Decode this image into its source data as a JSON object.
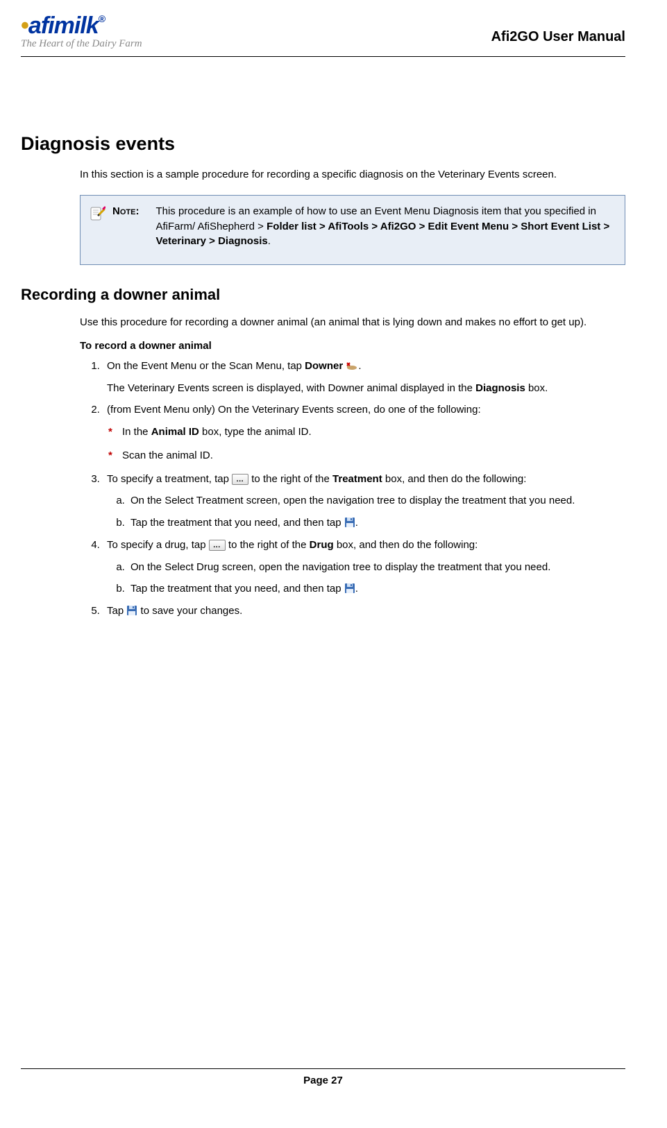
{
  "header": {
    "brand": "afimilk",
    "tagline": "The Heart of the Dairy Farm",
    "doc_title": "Afi2GO User Manual"
  },
  "h1": "Diagnosis events",
  "intro": "In this section is a sample procedure for recording a specific diagnosis on the Veterinary Events screen.",
  "note": {
    "label": "Note:",
    "text_a": "This procedure is an example of how to use an Event Menu Diagnosis item that you specified in AfiFarm/ AfiShepherd > ",
    "bold_path": "Folder list > AfiTools > Afi2GO > Edit Event Menu > Short Event List > Veterinary > Diagnosis",
    "period": "."
  },
  "h2": "Recording a downer animal",
  "sub_intro": "Use this procedure for recording a downer animal (an animal that is lying down and makes no effort to get up).",
  "proc_heading": "To record a downer animal",
  "step1": {
    "a": "On the Event Menu or the Scan Menu, tap ",
    "bold": "Downer",
    "b": " ",
    "c": ".",
    "result_a": "The Veterinary Events screen is displayed, with Downer animal displayed in the ",
    "result_bold": "Diagnosis",
    "result_b": " box."
  },
  "step2": {
    "lead": "(from Event Menu only) On the Veterinary Events screen, do one of the following:",
    "opt1_a": "In the ",
    "opt1_bold": "Animal ID",
    "opt1_b": " box, type the animal ID.",
    "opt2": "Scan the animal ID."
  },
  "step3": {
    "a": "To specify a treatment, tap ",
    "b": " to the right of the ",
    "bold": "Treatment",
    "c": " box, and then do the following:",
    "sub_a": "On the Select Treatment screen, open the navigation tree to display the treatment that you need.",
    "sub_b1": "Tap the treatment that you need, and then tap ",
    "sub_b2": "."
  },
  "step4": {
    "a": "To specify a drug, tap ",
    "b": " to the right of the ",
    "bold": "Drug",
    "c": " box, and then do the following:",
    "sub_a": "On the Select Drug screen, open the navigation tree to display the treatment that you need.",
    "sub_b1": "Tap the treatment that you need, and then tap ",
    "sub_b2": "."
  },
  "step5": {
    "a": "Tap ",
    "b": " to save your changes."
  },
  "footer": "Page 27",
  "icons": {
    "ellipsis": "…"
  }
}
